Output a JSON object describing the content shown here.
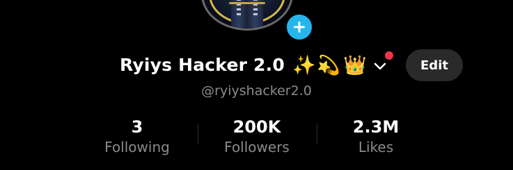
{
  "profile": {
    "display_name": "Ryiys Hacker 2.0",
    "name_emojis": [
      "✨",
      "💫",
      "👑"
    ],
    "handle": "@ryiyshacker2.0",
    "has_notification_dot": true
  },
  "actions": {
    "edit_label": "Edit",
    "add_icon": "plus-icon",
    "dropdown_icon": "chevron-down-icon"
  },
  "stats": [
    {
      "value": "3",
      "label": "Following"
    },
    {
      "value": "200K",
      "label": "Followers"
    },
    {
      "value": "2.3M",
      "label": "Likes"
    }
  ],
  "colors": {
    "background": "#000000",
    "accent_plus": "#26b5ea",
    "notification_dot": "#f2344b",
    "edit_button_bg": "#2a2a2a",
    "secondary_text": "#8b8b8b"
  }
}
